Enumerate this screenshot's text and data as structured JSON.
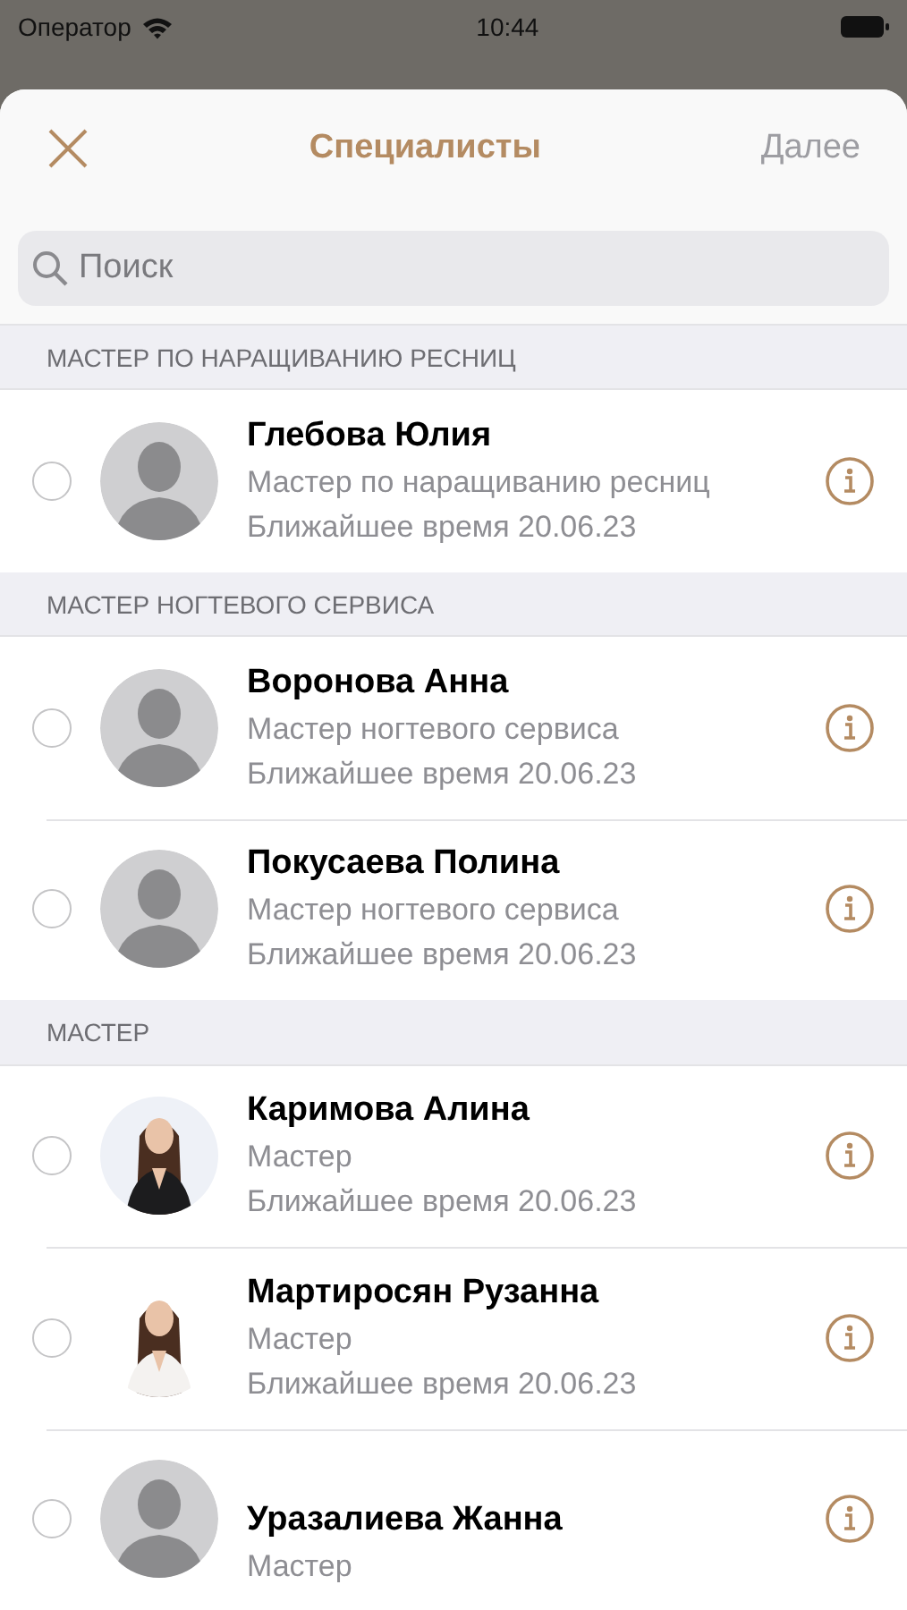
{
  "status_bar": {
    "carrier": "Оператор",
    "time": "10:44"
  },
  "nav": {
    "title": "Специалисты",
    "next": {
      "label": "Далее",
      "disabled": true
    }
  },
  "search": {
    "placeholder": "Поиск"
  },
  "sections": [
    {
      "title": "МАСТЕР ПО НАРАЩИВАНИЮ РЕСНИЦ",
      "specialists": [
        {
          "name": "Глебова Юлия",
          "role": "Мастер по наращиванию ресниц",
          "time": "Ближайшее время 20.06.23",
          "selected": false,
          "kind": "placeholder"
        }
      ]
    },
    {
      "title": "МАСТЕР НОГТЕВОГО СЕРВИСА",
      "specialists": [
        {
          "name": "Воронова Анна",
          "role": "Мастер ногтевого сервиса",
          "time": "Ближайшее время 20.06.23",
          "selected": false,
          "kind": "placeholder"
        },
        {
          "name": "Покусаева Полина",
          "role": "Мастер ногтевого сервиса",
          "time": "Ближайшее время 20.06.23",
          "selected": false,
          "kind": "placeholder"
        }
      ]
    },
    {
      "title": "МАСТЕР",
      "specialists": [
        {
          "name": "Каримова Алина",
          "role": "Мастер",
          "time": "Ближайшее время 20.06.23",
          "selected": false,
          "kind": "picture"
        },
        {
          "name": "Мартиросян Рузанна",
          "role": "Мастер",
          "time": "Ближайшее время 20.06.23",
          "selected": false,
          "kind": "picture"
        },
        {
          "name": "Уразалиева Жанна",
          "role": "Мастер",
          "selected": false,
          "kind": "placeholder"
        }
      ]
    }
  ]
}
